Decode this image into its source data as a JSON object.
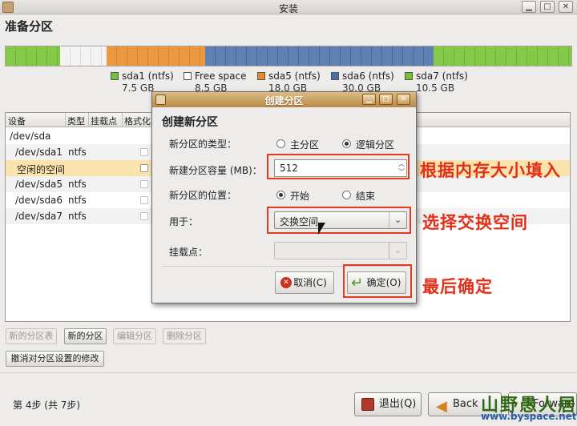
{
  "window": {
    "title": "安装",
    "minimize": "▁",
    "maximize": "□",
    "close": "✕"
  },
  "page_title": "准备分区",
  "partition_bar": {
    "segments": [
      {
        "color": "#73c22f",
        "fraction": 0.097
      },
      {
        "color": "#e9e9e9",
        "fraction": 0.082
      },
      {
        "color": "#ea8a28",
        "fraction": 0.173
      },
      {
        "color": "#4a6fa8",
        "fraction": 0.405
      },
      {
        "color": "#73c22f",
        "fraction": 0.243
      }
    ],
    "legend": [
      {
        "name": "sda1 (ntfs)",
        "size": "7.5 GB",
        "color": "#73c22f"
      },
      {
        "name": "Free space",
        "size": "8.5 GB",
        "color": "#ffffff"
      },
      {
        "name": "sda5 (ntfs)",
        "size": "18.0 GB",
        "color": "#ea8a28"
      },
      {
        "name": "sda6 (ntfs)",
        "size": "30.0 GB",
        "color": "#4a6fa8"
      },
      {
        "name": "sda7 (ntfs)",
        "size": "10.5 GB",
        "color": "#73c22f"
      }
    ]
  },
  "table": {
    "headers": [
      "设备",
      "类型",
      "挂载点",
      "格式化"
    ],
    "rows": [
      {
        "device": "/dev/sda",
        "type": "",
        "check": false
      },
      {
        "device": "/dev/sda1",
        "type": "ntfs",
        "check": true
      },
      {
        "device": "空闲的空间",
        "type": "",
        "check": true
      },
      {
        "device": "/dev/sda5",
        "type": "ntfs",
        "check": true
      },
      {
        "device": "/dev/sda6",
        "type": "ntfs",
        "check": true
      },
      {
        "device": "/dev/sda7",
        "type": "ntfs",
        "check": true
      }
    ]
  },
  "buttons": {
    "new_table": "新的分区表",
    "new_partition": "新的分区",
    "edit_partition": "编辑分区",
    "delete_partition": "删除分区",
    "undo": "撤消对分区设置的修改"
  },
  "footer": {
    "step": "第 4步 (共 7步)",
    "quit": "退出(Q)",
    "back": "Back",
    "forward": "Forward"
  },
  "dialog": {
    "title": "创建分区",
    "heading": "创建新分区",
    "type_label": "新分区的类型：",
    "primary": "主分区",
    "logical": "逻辑分区",
    "size_label": "新建分区容量 (MB)：",
    "size_value": "512",
    "location_label": "新分区的位置：",
    "begin": "开始",
    "end": "结束",
    "use_label": "用于：",
    "use_value": "交换空间",
    "mount_label": "挂载点：",
    "cancel": "取消(C)",
    "ok": "确定(O)"
  },
  "annotations": {
    "size_hint": "根据内存大小填入",
    "swap_hint": "选择交换空间",
    "ok_hint": "最后确定"
  },
  "watermark": {
    "text": "山野愚人居",
    "url": "www.byspace.net"
  }
}
